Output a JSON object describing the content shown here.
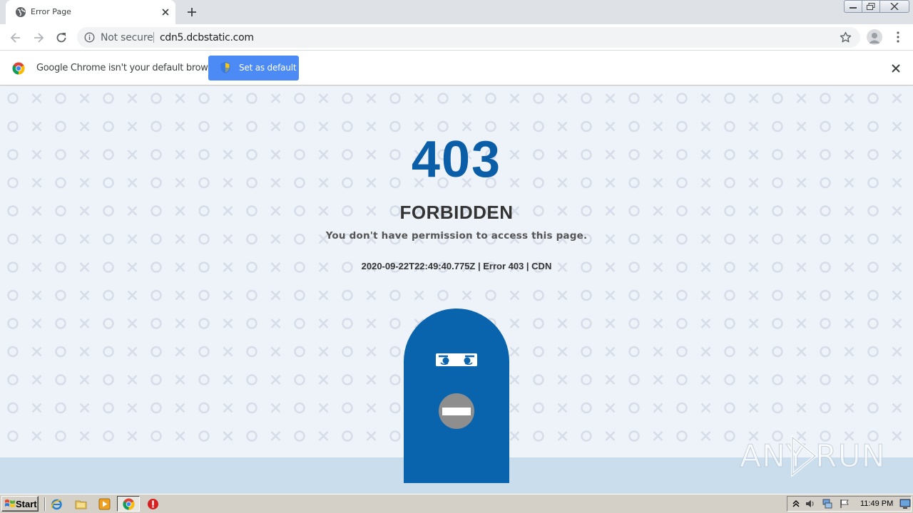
{
  "browser": {
    "tab": {
      "title": "Error Page"
    },
    "omnibox": {
      "security_label": "Not secure",
      "url": "cdn5.dcbstatic.com"
    },
    "infobar": {
      "message": "Google Chrome isn't your default browser",
      "button_label": "Set as default"
    }
  },
  "page": {
    "error_code": "403",
    "error_title": "FORBIDDEN",
    "error_message": "You don't have permission to access this page.",
    "error_meta": "2020-09-22T22:49:40.775Z | Error 403 | CDN",
    "pattern": {
      "symbols": [
        "circle",
        "x"
      ]
    },
    "colors": {
      "background": "#eef2f9",
      "floor": "#c9dded",
      "accent": "#0a5ea8",
      "door": "#0a64ad"
    }
  },
  "watermark": {
    "left_text": "ANY",
    "right_text": "RUN"
  },
  "taskbar": {
    "start_label": "Start",
    "quick_launch": [
      "internet-explorer-icon",
      "folder-icon",
      "media-player-icon",
      "chrome-icon",
      "stop-icon"
    ],
    "tray_icons": [
      "chevron-up-icon",
      "speaker-icon",
      "network-icon",
      "flag-icon"
    ],
    "clock": "11:49 PM"
  }
}
